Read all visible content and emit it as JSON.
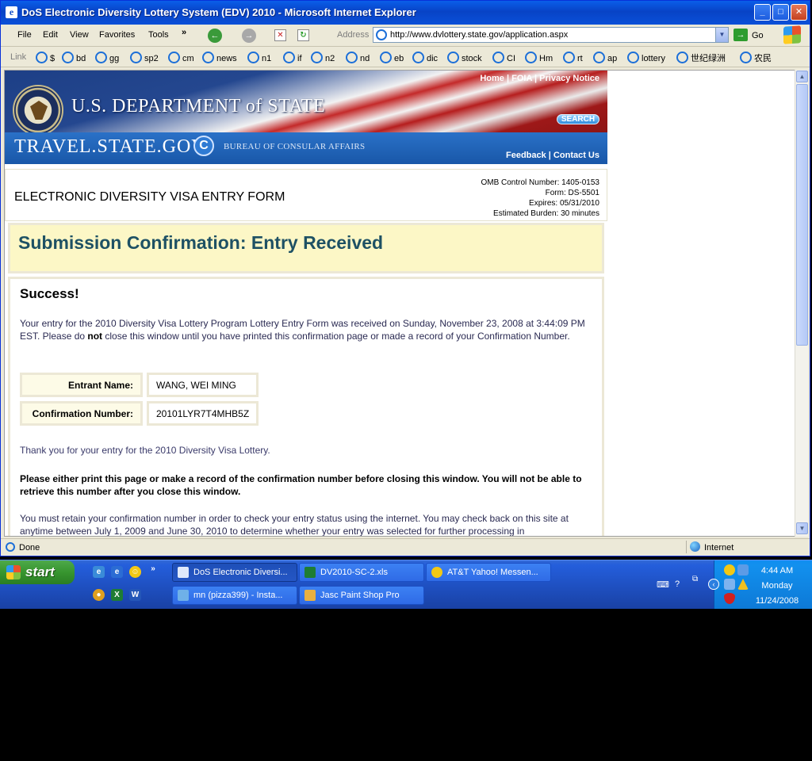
{
  "window": {
    "title": "DoS Electronic Diversity Lottery System (EDV) 2010 - Microsoft Internet Explorer",
    "minimize_glyph": "_",
    "maximize_glyph": "□",
    "close_glyph": "✕"
  },
  "menu": {
    "items": [
      "File",
      "Edit",
      "View",
      "Favorites",
      "Tools"
    ],
    "more": "»"
  },
  "address": {
    "label": "Address",
    "url": "http://www.dvlottery.state.gov/application.aspx",
    "go_label": "Go"
  },
  "links": {
    "label": "Link",
    "items": [
      "$",
      "bd",
      "gg",
      "sp2",
      "cm",
      "news",
      "n1",
      "if",
      "n2",
      "nd",
      "eb",
      "dic",
      "stock",
      "CI",
      "Hm",
      "rt",
      "ap",
      "lottery",
      "世纪绿洲",
      "农民"
    ]
  },
  "banner": {
    "top_links": "Home | FOIA | Privacy Notice",
    "department": "U.S. DEPARTMENT of STATE",
    "search_label": "SEARCH",
    "site_name": "TRAVEL.STATE.GOV",
    "bureau": "BUREAU OF CONSULAR AFFAIRS",
    "bottom_links": "Feedback | Contact Us"
  },
  "form_header": {
    "title": "ELECTRONIC DIVERSITY VISA ENTRY FORM",
    "omb_control": "OMB Control Number: 1405-0153",
    "form_no": "Form: DS-5501",
    "expires": "Expires: 05/31/2010",
    "burden": "Estimated Burden: 30 minutes"
  },
  "confirmation": {
    "heading": "Submission Confirmation: Entry Received"
  },
  "content": {
    "success": "Success!",
    "p1_before": "Your entry for the 2010 Diversity Visa Lottery Program Lottery Entry Form was received on Sunday, November 23, 2008 at 3:44:09 PM EST. Please do ",
    "p1_bold": "not",
    "p1_after": " close this window until you have printed this confirmation page or made a record of your Confirmation Number.",
    "entrant_label": "Entrant Name:",
    "entrant_value": "WANG, WEI MING",
    "confirmation_label": "Confirmation Number:",
    "confirmation_value": "20101LYR7T4MHB5Z",
    "p2": "Thank you for your entry for the 2010 Diversity Visa Lottery.",
    "p3": "Please either print this page or make a record of the confirmation number before closing this window. You will not be able to retrieve this number after you close this window.",
    "p4": "You must retain your confirmation number in order to check your entry status using the internet. You may check back on this site at anytime between July 1, 2009 and June 30, 2010 to determine whether your entry was selected for further processing in"
  },
  "status": {
    "text": "Done",
    "zone": "Internet"
  },
  "taskbar": {
    "start_label": "start",
    "tasks": [
      "DoS Electronic Diversi...",
      "DV2010-SC-2.xls",
      "AT&T Yahoo! Messen...",
      "mn (pizza399) - Insta...",
      "Jasc Paint Shop Pro"
    ],
    "time": "4:44 AM",
    "day": "Monday",
    "date": "11/24/2008"
  }
}
